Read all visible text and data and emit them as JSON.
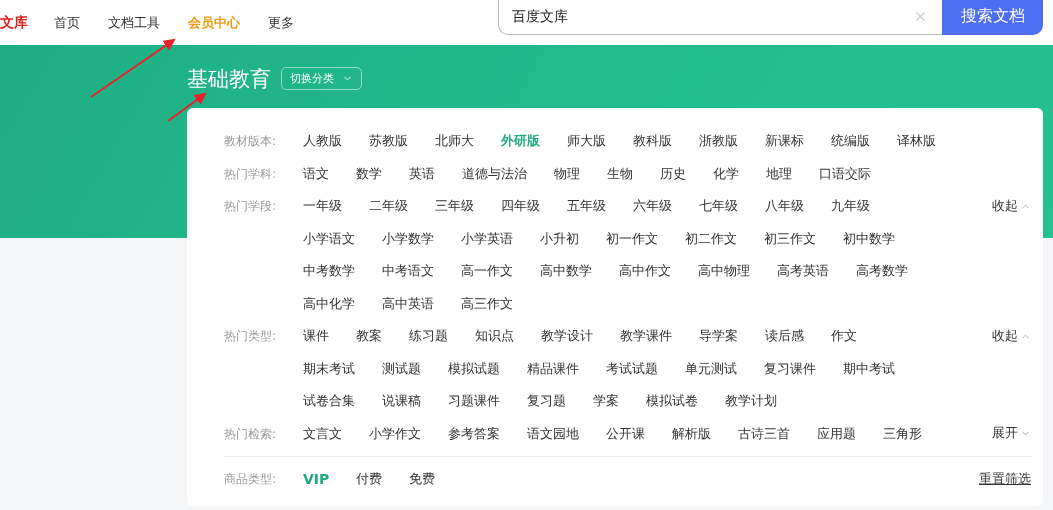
{
  "nav": {
    "logo": "文库",
    "items": [
      {
        "label": "首页",
        "selected": false
      },
      {
        "label": "文档工具",
        "selected": false
      },
      {
        "label": "会员中心",
        "selected": true
      },
      {
        "label": "更多",
        "selected": false
      }
    ]
  },
  "search": {
    "value": "百度文库",
    "button": "搜索文档"
  },
  "banner": {
    "title": "基础教育",
    "switch_button": "切换分类"
  },
  "filters": [
    {
      "label": "教材版本:",
      "lines": [
        [
          {
            "label": "人教版",
            "selected": false
          },
          {
            "label": "苏教版",
            "selected": false
          },
          {
            "label": "北师大",
            "selected": false
          },
          {
            "label": "外研版",
            "selected": true
          },
          {
            "label": "师大版",
            "selected": false
          },
          {
            "label": "教科版",
            "selected": false
          },
          {
            "label": "浙教版",
            "selected": false
          },
          {
            "label": "新课标",
            "selected": false
          },
          {
            "label": "统编版",
            "selected": false
          },
          {
            "label": "译林版",
            "selected": false
          }
        ]
      ]
    },
    {
      "label": "热门学科:",
      "lines": [
        [
          {
            "label": "语文",
            "selected": false
          },
          {
            "label": "数学",
            "selected": false
          },
          {
            "label": "英语",
            "selected": false
          },
          {
            "label": "道德与法治",
            "selected": false
          },
          {
            "label": "物理",
            "selected": false
          },
          {
            "label": "生物",
            "selected": false
          },
          {
            "label": "历史",
            "selected": false
          },
          {
            "label": "化学",
            "selected": false
          },
          {
            "label": "地理",
            "selected": false
          },
          {
            "label": "口语交际",
            "selected": false
          }
        ]
      ]
    },
    {
      "label": "热门学段:",
      "toggle": {
        "label": "收起",
        "expanded": true
      },
      "lines": [
        [
          {
            "label": "一年级",
            "selected": false
          },
          {
            "label": "二年级",
            "selected": false
          },
          {
            "label": "三年级",
            "selected": false
          },
          {
            "label": "四年级",
            "selected": false
          },
          {
            "label": "五年级",
            "selected": false
          },
          {
            "label": "六年级",
            "selected": false
          },
          {
            "label": "七年级",
            "selected": false
          },
          {
            "label": "八年级",
            "selected": false
          },
          {
            "label": "九年级",
            "selected": false
          }
        ],
        [
          {
            "label": "小学语文",
            "selected": false
          },
          {
            "label": "小学数学",
            "selected": false
          },
          {
            "label": "小学英语",
            "selected": false
          },
          {
            "label": "小升初",
            "selected": false
          },
          {
            "label": "初一作文",
            "selected": false
          },
          {
            "label": "初二作文",
            "selected": false
          },
          {
            "label": "初三作文",
            "selected": false
          },
          {
            "label": "初中数学",
            "selected": false
          }
        ],
        [
          {
            "label": "中考数学",
            "selected": false
          },
          {
            "label": "中考语文",
            "selected": false
          },
          {
            "label": "高一作文",
            "selected": false
          },
          {
            "label": "高中数学",
            "selected": false
          },
          {
            "label": "高中作文",
            "selected": false
          },
          {
            "label": "高中物理",
            "selected": false
          },
          {
            "label": "高考英语",
            "selected": false
          },
          {
            "label": "高考数学",
            "selected": false
          }
        ],
        [
          {
            "label": "高中化学",
            "selected": false
          },
          {
            "label": "高中英语",
            "selected": false
          },
          {
            "label": "高三作文",
            "selected": false
          }
        ]
      ]
    },
    {
      "label": "热门类型:",
      "toggle": {
        "label": "收起",
        "expanded": true
      },
      "lines": [
        [
          {
            "label": "课件",
            "selected": false
          },
          {
            "label": "教案",
            "selected": false
          },
          {
            "label": "练习题",
            "selected": false
          },
          {
            "label": "知识点",
            "selected": false
          },
          {
            "label": "教学设计",
            "selected": false
          },
          {
            "label": "教学课件",
            "selected": false
          },
          {
            "label": "导学案",
            "selected": false
          },
          {
            "label": "读后感",
            "selected": false
          },
          {
            "label": "作文",
            "selected": false
          }
        ],
        [
          {
            "label": "期末考试",
            "selected": false
          },
          {
            "label": "测试题",
            "selected": false
          },
          {
            "label": "模拟试题",
            "selected": false
          },
          {
            "label": "精品课件",
            "selected": false
          },
          {
            "label": "考试试题",
            "selected": false
          },
          {
            "label": "单元测试",
            "selected": false
          },
          {
            "label": "复习课件",
            "selected": false
          },
          {
            "label": "期中考试",
            "selected": false
          }
        ],
        [
          {
            "label": "试卷合集",
            "selected": false
          },
          {
            "label": "说课稿",
            "selected": false
          },
          {
            "label": "习题课件",
            "selected": false
          },
          {
            "label": "复习题",
            "selected": false
          },
          {
            "label": "学案",
            "selected": false
          },
          {
            "label": "模拟试卷",
            "selected": false
          },
          {
            "label": "教学计划",
            "selected": false
          }
        ]
      ]
    },
    {
      "label": "热门检索:",
      "toggle": {
        "label": "展开",
        "expanded": false
      },
      "lines": [
        [
          {
            "label": "文言文",
            "selected": false
          },
          {
            "label": "小学作文",
            "selected": false
          },
          {
            "label": "参考答案",
            "selected": false
          },
          {
            "label": "语文园地",
            "selected": false
          },
          {
            "label": "公开课",
            "selected": false
          },
          {
            "label": "解析版",
            "selected": false
          },
          {
            "label": "古诗三首",
            "selected": false
          },
          {
            "label": "应用题",
            "selected": false
          },
          {
            "label": "三角形",
            "selected": false
          }
        ]
      ]
    }
  ],
  "product_type": {
    "label": "商品类型:",
    "items": [
      {
        "label": "VIP",
        "selected": true
      },
      {
        "label": "付费",
        "selected": false
      },
      {
        "label": "免费",
        "selected": false
      }
    ],
    "reset": "重置筛选"
  }
}
